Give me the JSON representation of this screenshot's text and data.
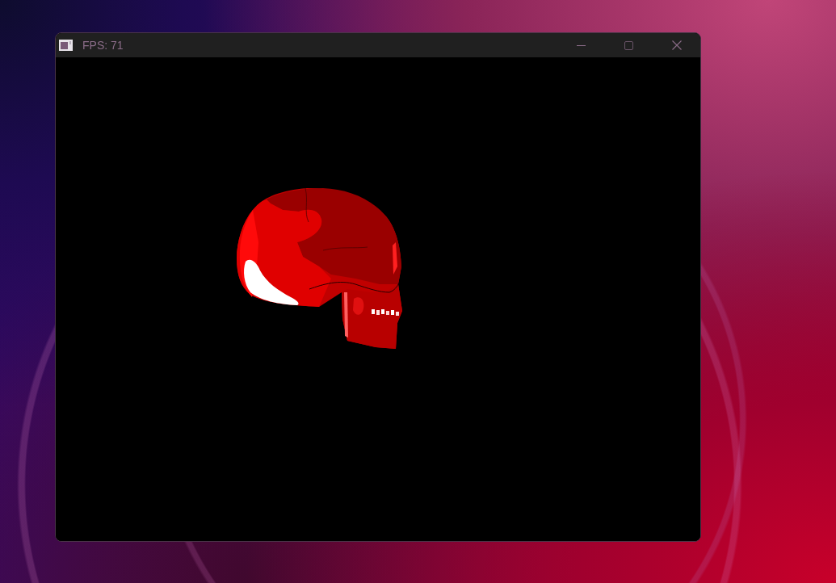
{
  "window": {
    "title": "FPS: 71"
  }
}
